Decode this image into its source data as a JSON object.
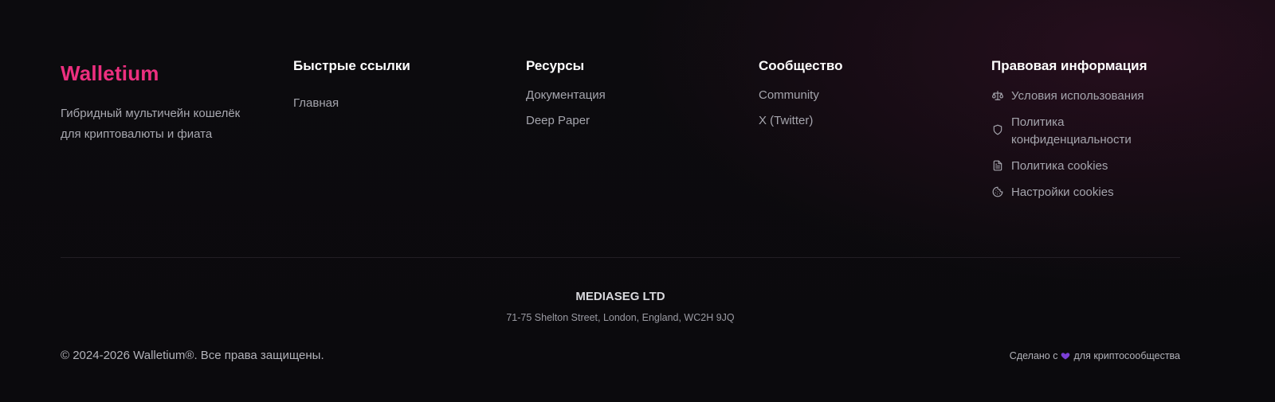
{
  "brand": {
    "name": "Walletium",
    "description": "Гибридный мультичейн кошелёк для криптовалюты и фиата",
    "accent_color": "#ec2f7f"
  },
  "columns": {
    "quick_links": {
      "title": "Быстрые ссылки",
      "items": [
        {
          "label": "Главная"
        }
      ]
    },
    "resources": {
      "title": "Ресурсы",
      "items": [
        {
          "label": "Документация"
        },
        {
          "label": "Deep Paper"
        }
      ]
    },
    "community": {
      "title": "Сообщество",
      "items": [
        {
          "label": "Community"
        },
        {
          "label": "X (Twitter)"
        }
      ]
    },
    "legal": {
      "title": "Правовая информация",
      "items": [
        {
          "label": "Условия использования",
          "icon": "scale-icon"
        },
        {
          "label": "Политика конфиденциальности",
          "icon": "shield-icon"
        },
        {
          "label": "Политика cookies",
          "icon": "document-icon"
        },
        {
          "label": "Настройки cookies",
          "icon": "cookie-icon"
        }
      ]
    }
  },
  "company": {
    "name": "MEDIASEG LTD",
    "address": "71-75 Shelton Street, London, England, WC2H 9JQ"
  },
  "bottom": {
    "copyright": "© 2024-2026 Walletium®. Все права защищены.",
    "made_with_prefix": "Сделано с",
    "made_with_suffix": "для криптосообщества",
    "heart_icon": "heart-icon",
    "heart_color": "#7b3fd6"
  }
}
